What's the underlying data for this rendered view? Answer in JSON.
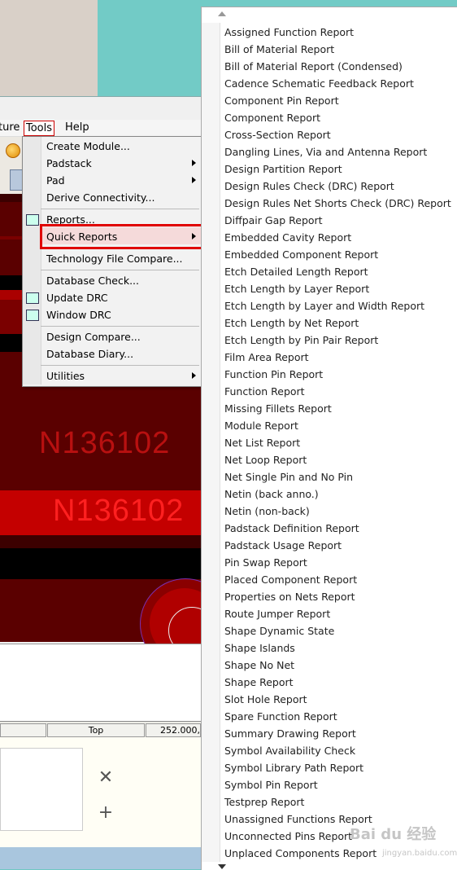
{
  "menubar": {
    "items": [
      "ture",
      "Tools",
      "Help"
    ]
  },
  "tools_menu": {
    "items": [
      {
        "label": "Create Module...",
        "submenu": false
      },
      {
        "label": "Padstack",
        "submenu": true
      },
      {
        "label": "Pad",
        "submenu": true
      },
      {
        "label": "Derive Connectivity...",
        "submenu": false
      },
      {
        "label": "Reports...",
        "submenu": false
      },
      {
        "label": "Quick Reports",
        "submenu": true,
        "highlighted": true
      },
      {
        "label": "Technology File Compare...",
        "submenu": false
      },
      {
        "label": "Database Check...",
        "submenu": false
      },
      {
        "label": "Update DRC",
        "submenu": false
      },
      {
        "label": "Window DRC",
        "submenu": false
      },
      {
        "label": "Design Compare...",
        "submenu": false
      },
      {
        "label": "Database Diary...",
        "submenu": false
      },
      {
        "label": "Utilities",
        "submenu": true
      }
    ]
  },
  "canvas": {
    "net_label_1": "N136102",
    "net_label_2": "N136102",
    "background_color": "#5a0000",
    "band_color": "#c00000"
  },
  "statusbar": {
    "layer": "Top",
    "coordinates": "252.000,"
  },
  "sidepanel": {
    "buttons": [
      "✕",
      "+"
    ]
  },
  "quick_reports": {
    "items": [
      "Assigned Function Report",
      "Bill of Material Report",
      "Bill of Material Report (Condensed)",
      "Cadence Schematic Feedback Report",
      "Component Pin Report",
      "Component Report",
      "Cross-Section Report",
      "Dangling Lines, Via and Antenna Report",
      "Design Partition Report",
      "Design Rules Check (DRC) Report",
      "Design Rules Net Shorts Check (DRC) Report",
      "Diffpair Gap Report",
      "Embedded Cavity Report",
      "Embedded Component Report",
      "Etch Detailed Length Report",
      "Etch Length by Layer Report",
      "Etch Length by Layer and Width Report",
      "Etch Length by Net Report",
      "Etch Length by Pin Pair Report",
      "Film Area Report",
      "Function Pin Report",
      "Function Report",
      "Missing Fillets Report",
      "Module Report",
      "Net List Report",
      "Net Loop Report",
      "Net Single Pin and No Pin",
      "Netin (back anno.)",
      "Netin (non-back)",
      "Padstack Definition Report",
      "Padstack Usage Report",
      "Pin Swap Report",
      "Placed Component Report",
      "Properties on Nets Report",
      "Route Jumper Report",
      "Shape Dynamic State",
      "Shape Islands",
      "Shape No Net",
      "Shape Report",
      "Slot Hole Report",
      "Spare Function Report",
      "Summary Drawing Report",
      "Symbol Availability Check",
      "Symbol Library Path Report",
      "Symbol Pin Report",
      "Testprep Report",
      "Unassigned Functions Report",
      "Unconnected Pins Report",
      "Unplaced Components Report"
    ]
  },
  "watermark": {
    "text": "Bai du 经验",
    "sub": "jingyan.baidu.com"
  }
}
